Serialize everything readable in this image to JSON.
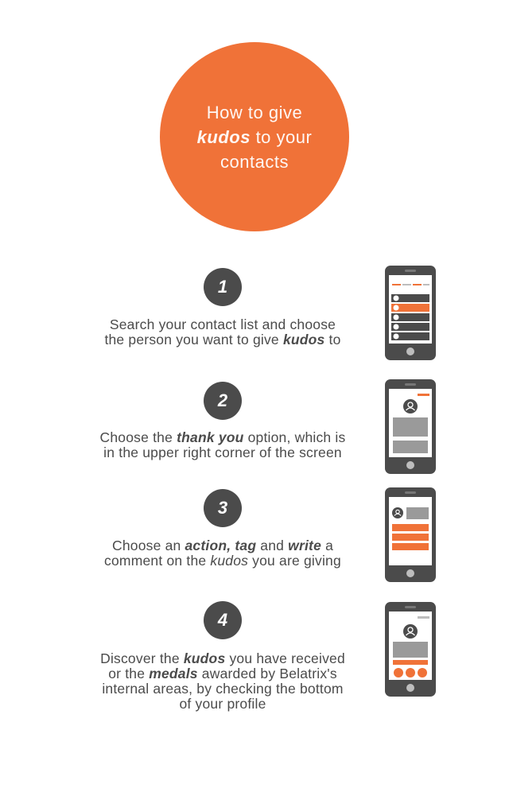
{
  "hero": {
    "line1": "How to give",
    "kudos": "kudos",
    "line2_rest": " to your",
    "line3": "contacts"
  },
  "steps": [
    {
      "number": "1",
      "parts": [
        {
          "t": "Search your contact list and choose",
          "s": "n"
        },
        {
          "t": "the person you want to give ",
          "s": "n"
        },
        {
          "t": "kudos",
          "s": "bi"
        },
        {
          "t": " to",
          "s": "n"
        }
      ]
    },
    {
      "number": "2",
      "parts": [
        {
          "t": "Choose the ",
          "s": "n"
        },
        {
          "t": "thank you",
          "s": "bi"
        },
        {
          "t": " option, which is",
          "s": "n"
        },
        {
          "t": "in the upper right corner of the screen",
          "s": "n"
        }
      ]
    },
    {
      "number": "3",
      "parts": [
        {
          "t": "Choose an ",
          "s": "n"
        },
        {
          "t": "action, tag",
          "s": "bi"
        },
        {
          "t": " and ",
          "s": "n"
        },
        {
          "t": "write",
          "s": "bi"
        },
        {
          "t": " a",
          "s": "n"
        },
        {
          "t": "comment on the ",
          "s": "n"
        },
        {
          "t": "kudos",
          "s": "i"
        },
        {
          "t": " you are giving",
          "s": "n"
        }
      ]
    },
    {
      "number": "4",
      "parts": [
        {
          "t": "Discover the ",
          "s": "n"
        },
        {
          "t": "kudos",
          "s": "bi"
        },
        {
          "t": " you have received",
          "s": "n"
        },
        {
          "t": "or the ",
          "s": "n"
        },
        {
          "t": "medals",
          "s": "bi"
        },
        {
          "t": " awarded by Belatrix's",
          "s": "n"
        },
        {
          "t": "internal areas, by checking the bottom",
          "s": "n"
        },
        {
          "t": "of your profile",
          "s": "n"
        }
      ]
    }
  ],
  "colors": {
    "accent": "#f07238",
    "dark": "#4b4b4b",
    "screen": "#ffffff",
    "placeholder": "#9a9a9a"
  },
  "icons": {
    "phone": "smartphone-icon",
    "user": "user-icon"
  }
}
